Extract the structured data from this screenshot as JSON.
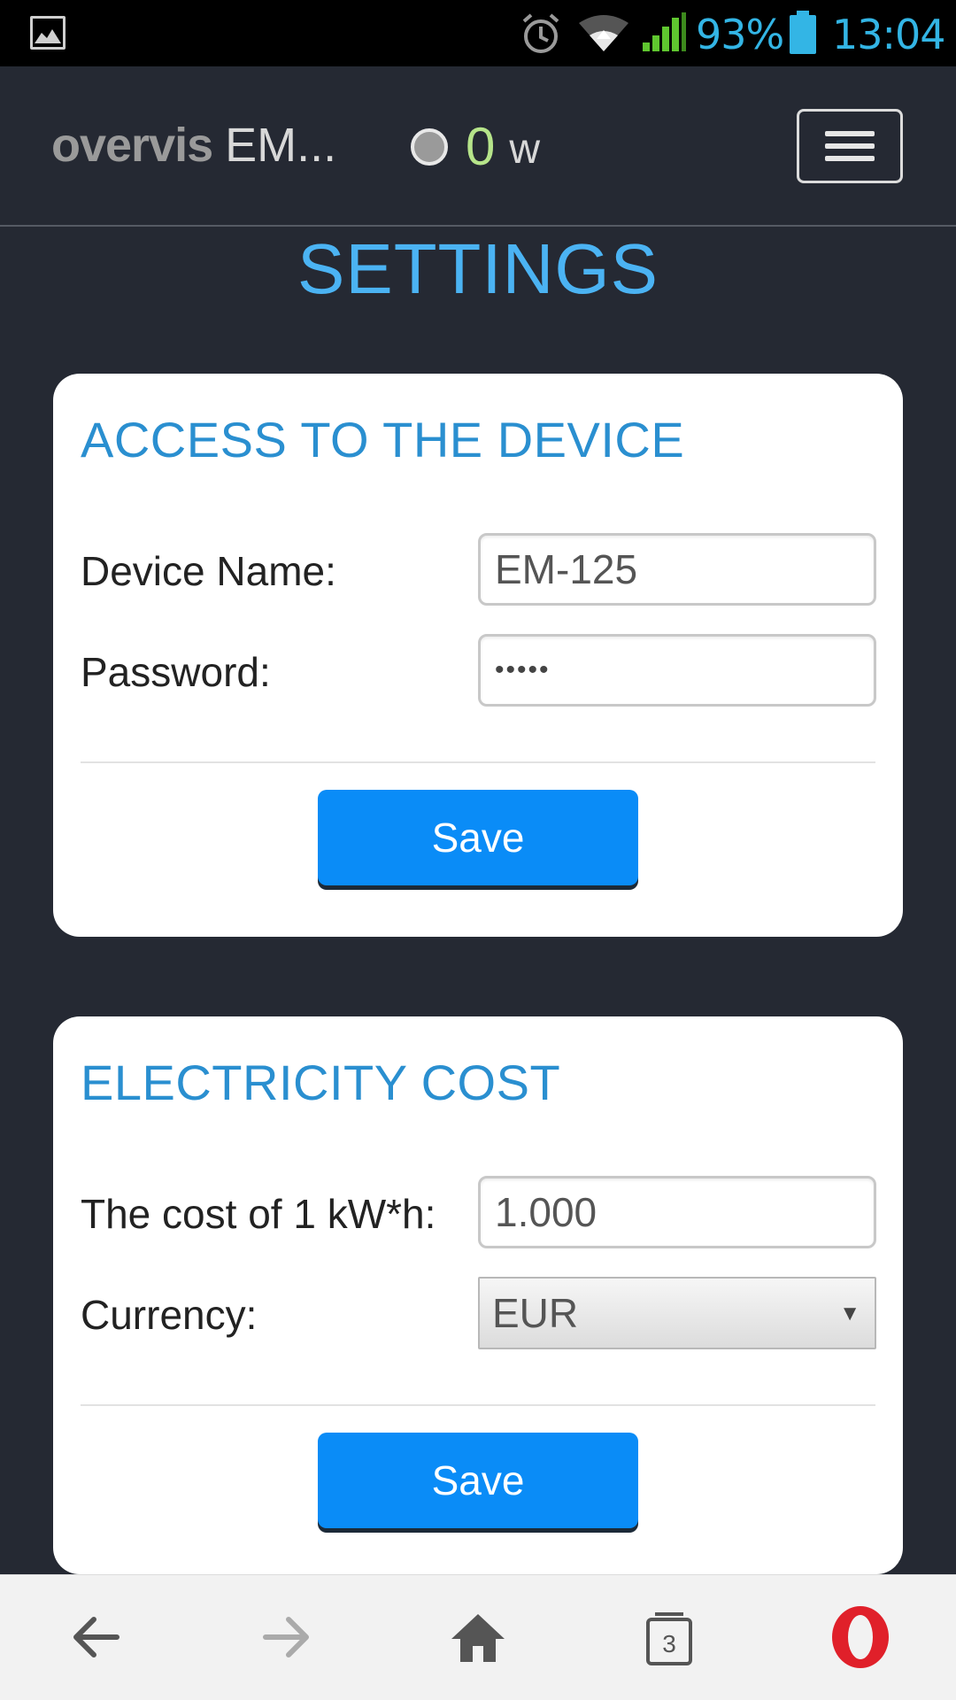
{
  "status_bar": {
    "battery_pct": "93%",
    "time": "13:04",
    "icons": [
      "image-icon",
      "alarm-icon",
      "wifi-icon",
      "signal-icon",
      "battery-icon"
    ]
  },
  "header": {
    "brand_name": "overvis",
    "device_short": "EM...",
    "power_value": "0",
    "power_unit": "w",
    "menu_icon": "hamburger-icon"
  },
  "page_title": "SETTINGS",
  "access_card": {
    "title": "ACCESS TO THE DEVICE",
    "device_name_label": "Device Name:",
    "device_name_value": "EM-125",
    "password_label": "Password:",
    "password_value": "•••••",
    "save_label": "Save"
  },
  "cost_card": {
    "title": "ELECTRICITY COST",
    "cost_label": "The cost of 1 kW*h:",
    "cost_value": "1.000",
    "currency_label": "Currency:",
    "currency_value": "EUR",
    "save_label": "Save"
  },
  "browser_bar": {
    "tab_count": "3",
    "icons": [
      "back-arrow-icon",
      "forward-arrow-icon",
      "home-icon",
      "tabs-icon",
      "opera-logo-icon"
    ]
  },
  "colors": {
    "background": "#252933",
    "title_blue": "#4bb3f3",
    "card_title_blue": "#2a8fd0",
    "button_blue": "#0a8cf7",
    "power_green": "#b6e48a",
    "status_blue": "#33b5e5"
  }
}
